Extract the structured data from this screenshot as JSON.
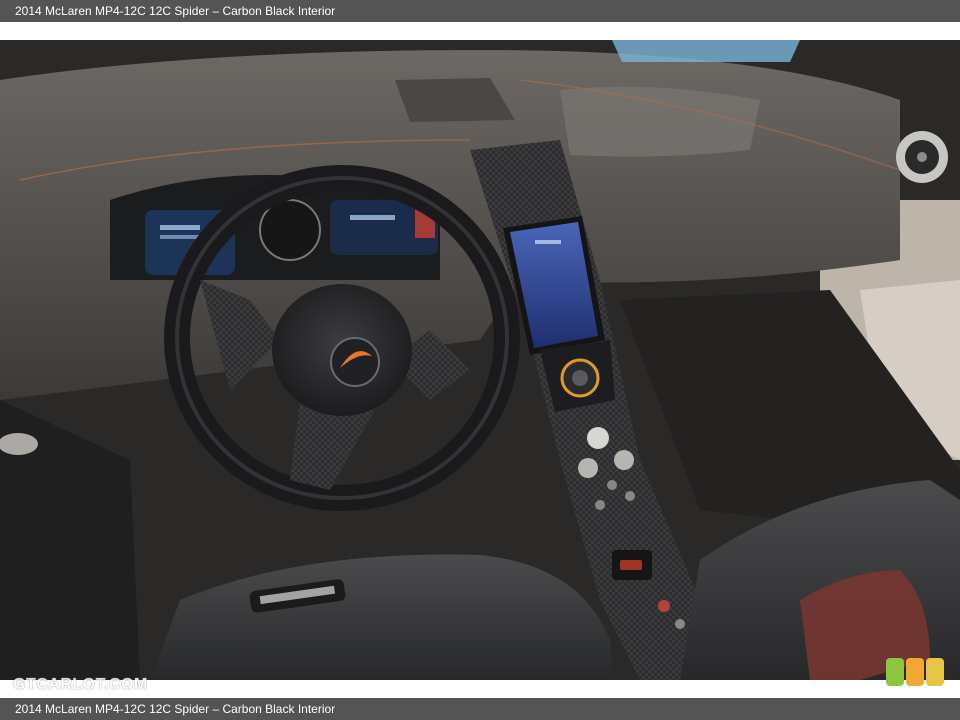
{
  "caption": {
    "top": "2014 McLaren MP4-12C 12C Spider – Carbon Black Interior",
    "bottom": "2014 McLaren MP4-12C 12C Spider – Carbon Black Interior"
  },
  "watermark": "GTCARLOT.COM",
  "colors": {
    "caption_bar": "#545454",
    "badge_green": "#8cc63f",
    "badge_orange": "#f0a830",
    "badge_yellow": "#e8c547"
  },
  "photo": {
    "subject": "McLaren MP4-12C Spider cockpit",
    "icons": [
      "steering-wheel-icon",
      "mclaren-logo-icon",
      "center-screen-icon",
      "air-vent-icon"
    ]
  }
}
